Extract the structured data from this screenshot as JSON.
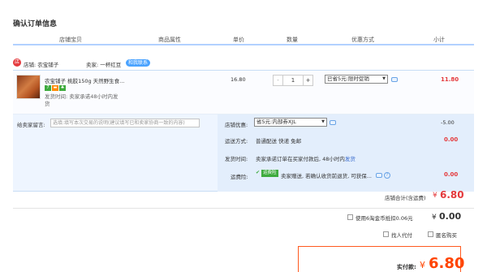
{
  "page_title": "确认订单信息",
  "columns": [
    "店铺宝贝",
    "商品属性",
    "单价",
    "数量",
    "优惠方式",
    "小计"
  ],
  "shop": {
    "label": "店铺: 农宝铺子",
    "seller": "卖家: 一杯红豆",
    "contact": "和我联系"
  },
  "item": {
    "name": "农宝铺子 桃胶150g 天然野生食...",
    "delivery_line1": "发货时间: 卖家承诺48小时内发",
    "delivery_line2": "货",
    "badge_text": "7",
    "price": "16.80",
    "quantity": "1",
    "minus": "-",
    "plus": "+",
    "discount_select": "已省5元:限时促销",
    "subtotal": "11.80"
  },
  "message": {
    "label": "给卖家留言:",
    "placeholder": "选填:填写本次交易的说明(建议填写已和卖家协商一致的内容)"
  },
  "coupon": {
    "label": "店铺优惠:",
    "select": "省5元:内部券XJL",
    "amount": "-5.00"
  },
  "shipping": {
    "label": "运送方式:",
    "value": "普通配送 快递 免邮",
    "amount": "0.00"
  },
  "delivery": {
    "label": "发货时间:",
    "value": "卖家承诺订单在买家付款后, 48小时内",
    "link": "发货"
  },
  "insurance": {
    "label": "运费险:",
    "tag": "运费险",
    "value": "卖家赠送, 若确认收货前退货, 可获保...",
    "amount": "0.00"
  },
  "shop_total": {
    "label": "店铺合计(含运费)",
    "currency": "¥",
    "value": "6.80"
  },
  "points": {
    "label": "使用6淘金币抵扣0.06元",
    "currency": "¥",
    "value": "0.00"
  },
  "options": {
    "proxy_pay": "找人代付",
    "anonymous": "匿名购买"
  },
  "final": {
    "label": "实付款:",
    "currency": "¥",
    "value": "6.80"
  },
  "colors": {
    "accent_red": "#e4393c",
    "accent_orange": "#ff4400",
    "header_line": "#b2d1ff",
    "section_bg": "#eef5ff"
  }
}
